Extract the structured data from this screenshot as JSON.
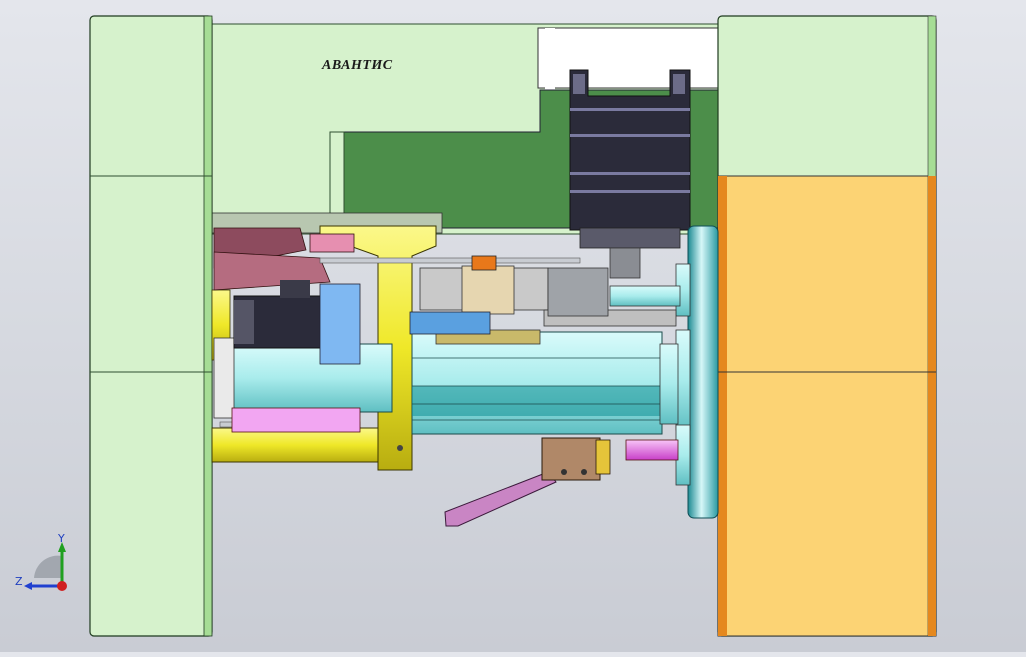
{
  "model": {
    "brand_label": "АВАНТИС"
  },
  "triad": {
    "y_label": "Y",
    "z_label": "Z"
  },
  "colors": {
    "background": "#d5d8df",
    "frame_green": "#d6f2cc",
    "panel_green": "#4c8e4a",
    "orange_panel": "#fcd374",
    "orange_edge": "#e5881e",
    "motor_black": "#2b2b3a",
    "cyan_spindle": "#bff3f3",
    "yellow_part": "#f6f03a",
    "pink_part": "#f2a6f2",
    "maroon_part": "#8d4b5e",
    "axis_x": "#d02020",
    "axis_y": "#20a020",
    "axis_z": "#2040d0"
  }
}
